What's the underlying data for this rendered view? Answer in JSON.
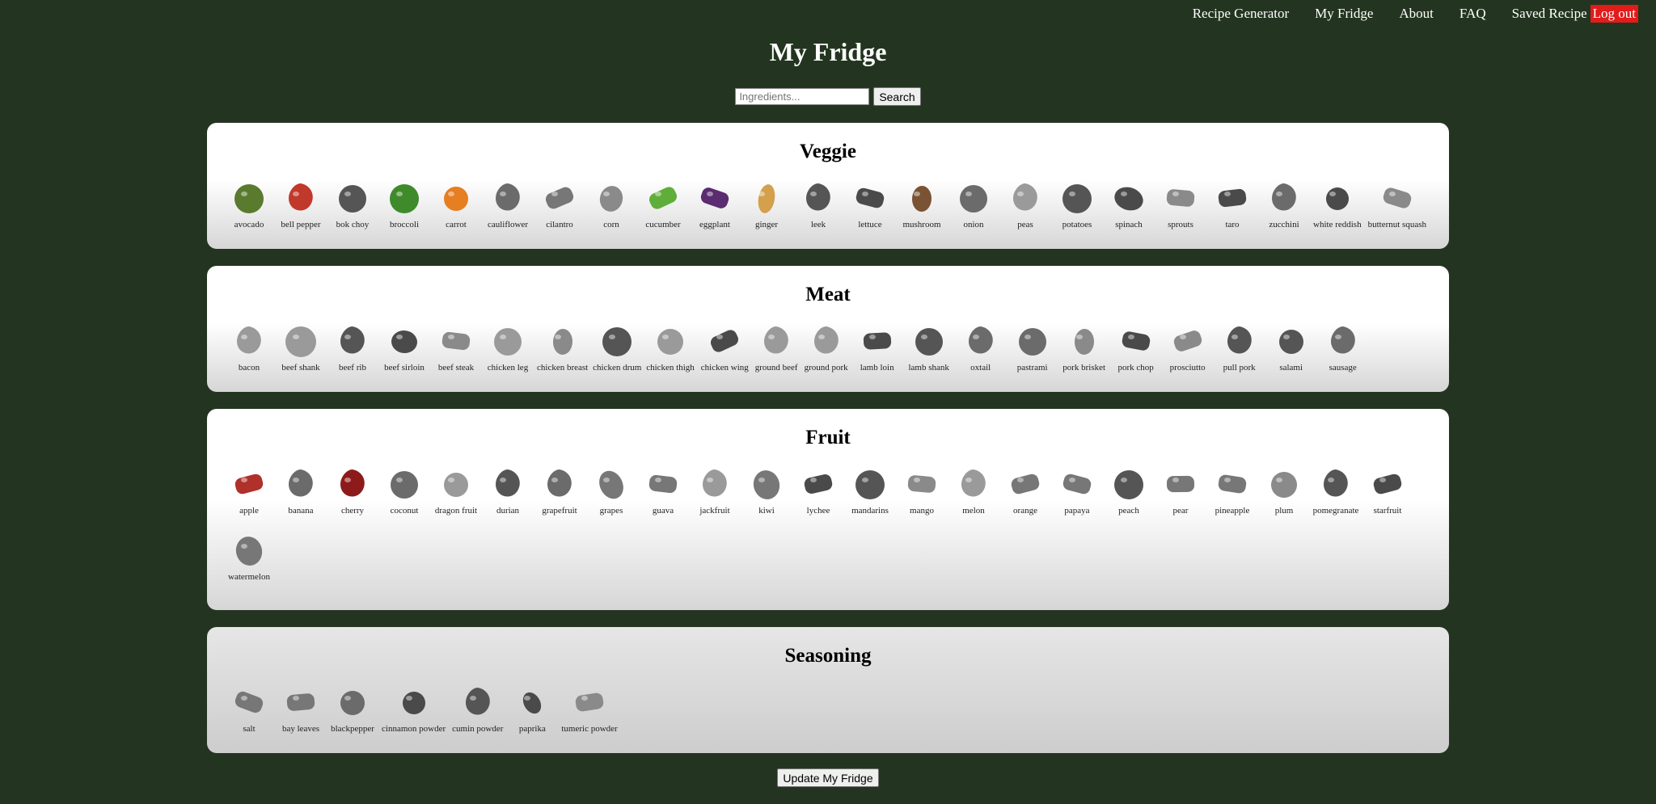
{
  "nav": {
    "links": [
      "Recipe Generator",
      "My Fridge",
      "About",
      "FAQ",
      "Saved Recipe"
    ],
    "logout": "Log out"
  },
  "title": "My Fridge",
  "search": {
    "placeholder": "Ingredients...",
    "value": "",
    "button": "Search"
  },
  "categories": [
    {
      "id": "veggie",
      "name": "Veggie",
      "items": [
        "avocado",
        "bell pepper",
        "bok choy",
        "broccoli",
        "carrot",
        "cauliflower",
        "cilantro",
        "corn",
        "cucumber",
        "eggplant",
        "ginger",
        "leek",
        "lettuce",
        "mushroom",
        "onion",
        "peas",
        "potatoes",
        "spinach",
        "sprouts",
        "taro",
        "zucchini",
        "white reddish",
        "butternut squash"
      ]
    },
    {
      "id": "meat",
      "name": "Meat",
      "items": [
        "bacon",
        "beef shank",
        "beef rib",
        "beef sirloin",
        "beef steak",
        "chicken leg",
        "chicken breast",
        "chicken drum",
        "chicken thigh",
        "chicken wing",
        "ground beef",
        "ground pork",
        "lamb loin",
        "lamb shank",
        "oxtail",
        "pastrami",
        "pork brisket",
        "pork chop",
        "prosciutto",
        "pull pork",
        "salami",
        "sausage"
      ]
    },
    {
      "id": "fruit",
      "name": "Fruit",
      "items": [
        "apple",
        "banana",
        "cherry",
        "coconut",
        "dragon fruit",
        "durian",
        "grapefruit",
        "grapes",
        "guava",
        "jackfruit",
        "kiwi",
        "lychee",
        "mandarins",
        "mango",
        "melon",
        "orange",
        "papaya",
        "peach",
        "pear",
        "pineapple",
        "plum",
        "pomegranate",
        "starfruit",
        "watermelon"
      ]
    },
    {
      "id": "seasoning",
      "name": "Seasoning",
      "items": [
        "salt",
        "bay leaves",
        "blackpepper",
        "cinnamon powder",
        "cumin powder",
        "paprika",
        "tumeric powder"
      ]
    }
  ],
  "color_items": [
    "avocado",
    "bell pepper",
    "broccoli",
    "carrot",
    "cucumber",
    "eggplant",
    "ginger",
    "mushroom",
    "apple",
    "cherry"
  ],
  "update_button": "Update My Fridge",
  "colors": {
    "background": "#233520",
    "logout": "#e21b1b"
  }
}
